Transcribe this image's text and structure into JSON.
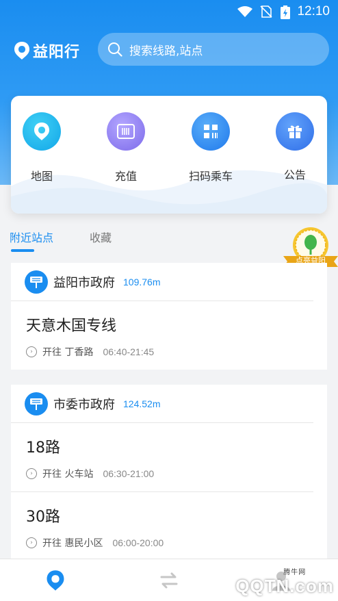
{
  "status_bar": {
    "time": "12:10"
  },
  "app": {
    "name": "益阳行"
  },
  "search": {
    "placeholder": "搜索线路,站点"
  },
  "functions": [
    {
      "label": "地图",
      "icon": "map-pin-icon",
      "color": "#12a6e8"
    },
    {
      "label": "充值",
      "icon": "card-icon",
      "color": "#8d7bf0"
    },
    {
      "label": "扫码乘车",
      "icon": "qr-code-icon",
      "color": "#2f8df5"
    },
    {
      "label": "公告",
      "icon": "gift-icon",
      "color": "#3b7ef2"
    }
  ],
  "tabs": [
    {
      "label": "附近站点"
    },
    {
      "label": "收藏"
    }
  ],
  "badge": {
    "text": "点亮益阳"
  },
  "stops": [
    {
      "name": "益阳市政府",
      "distance": "109.76m",
      "routes": [
        {
          "name": "天意木国专线",
          "direction": "开往 丁香路",
          "time": "06:40-21:45"
        }
      ]
    },
    {
      "name": "市委市政府",
      "distance": "124.52m",
      "routes": [
        {
          "name": "18路",
          "direction": "开往 火车站",
          "time": "06:30-21:00"
        },
        {
          "name": "30路",
          "direction": "开往 惠民小区",
          "time": "06:00-20:00"
        }
      ]
    }
  ],
  "watermark": {
    "text": "QQTN.com",
    "small": "腾牛网"
  },
  "colors": {
    "accent": "#1a8df0"
  }
}
